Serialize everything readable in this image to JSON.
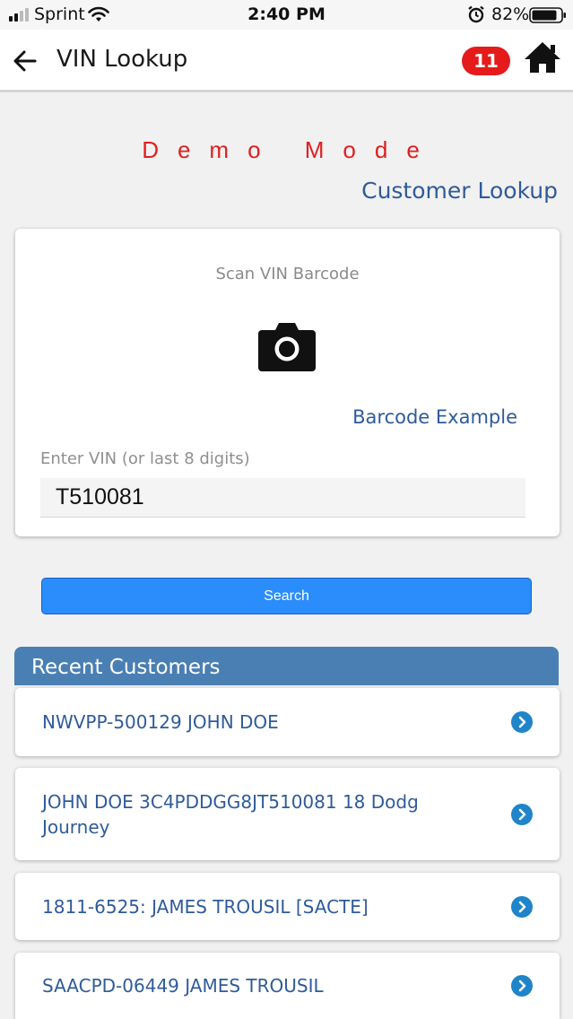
{
  "status_bar": {
    "carrier": "Sprint",
    "time": "2:40 PM",
    "battery_pct": "82%"
  },
  "nav": {
    "title": "VIN Lookup",
    "badge_count": "11"
  },
  "demo_mode": "Demo Mode",
  "customer_lookup": "Customer Lookup",
  "scan": {
    "label": "Scan VIN Barcode",
    "barcode_example": "Barcode Example",
    "vin_label": "Enter VIN (or last 8 digits)",
    "vin_value": "T510081"
  },
  "search_label": "Search",
  "recent": {
    "header": "Recent Customers",
    "items": [
      {
        "text": "NWVPP-500129 JOHN DOE"
      },
      {
        "text": "JOHN DOE 3C4PDDGG8JT510081 18 Dodg Journey"
      },
      {
        "text": "1811-6525: JAMES TROUSIL [SACTE]"
      },
      {
        "text": "SAACPD-06449 JAMES TROUSIL"
      }
    ]
  },
  "colors": {
    "accent_blue": "#2b8dfb",
    "link_blue": "#2f5b9a",
    "header_blue": "#4a7fb3",
    "demo_red": "#e02020",
    "badge_red": "#e51b1b"
  }
}
